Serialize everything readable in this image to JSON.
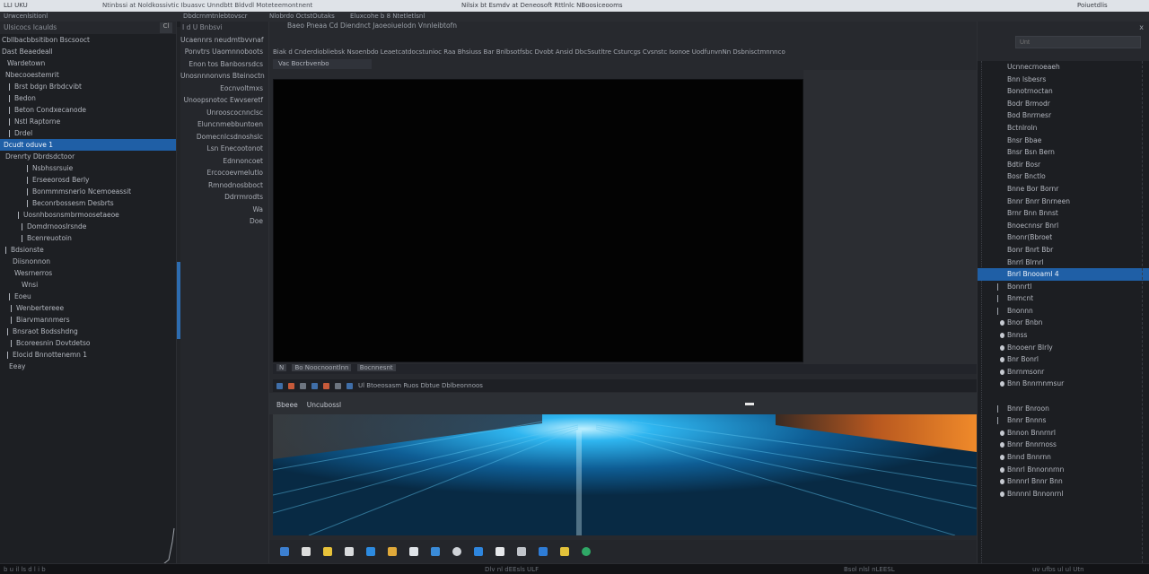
{
  "window": {
    "title_left": "LLI UKU",
    "title_main": "Ntinbssi at Noldkossivtic Ibuasvc Unndbtt Bldvdl Moteteemontnent",
    "title_center": "Nilsix bt Esmdv at Deneosoft Rttlnlc NBoosiceooms",
    "title_right": "Poiuetdlis"
  },
  "menubar": {
    "items": [
      "Urwcenlsitionl",
      "Dbdcrnmtnlebtovscr",
      "Nlobrdo OctstOutaks",
      "Eluxcohe b 8 Ntetletlsnl"
    ]
  },
  "left_panel": {
    "header": "Ulsicocs Icaulds",
    "header_button": "Cl",
    "rows": [
      {
        "label": "Cbllbacbbsitibon  Bscsooct",
        "indent": 0,
        "tick": false,
        "selected": false
      },
      {
        "label": "Dast Beaedeall",
        "indent": 0,
        "tick": false,
        "selected": false
      },
      {
        "label": "Wardetown",
        "indent": 6,
        "tick": false,
        "selected": false
      },
      {
        "label": "Nbecooestemrit",
        "indent": 4,
        "tick": false,
        "selected": false
      },
      {
        "label": "Brst  bdgn Brbdcvibt",
        "indent": 8,
        "tick": true,
        "selected": false
      },
      {
        "label": "Bedon",
        "indent": 8,
        "tick": true,
        "selected": false
      },
      {
        "label": "Beton  Condxecanode",
        "indent": 8,
        "tick": true,
        "selected": false
      },
      {
        "label": "Nstl Raptorne",
        "indent": 8,
        "tick": true,
        "selected": false
      },
      {
        "label": "Drdel",
        "indent": 8,
        "tick": true,
        "selected": false
      },
      {
        "label": "Dcudt oduve 1",
        "indent": 2,
        "tick": false,
        "selected": true
      },
      {
        "label": "Drenrty  Dbrdsdctoor",
        "indent": 4,
        "tick": false,
        "selected": false
      },
      {
        "label": "Nsbhssrsuie",
        "indent": 28,
        "tick": true,
        "selected": false
      },
      {
        "label": "Erseeorosd Berly",
        "indent": 28,
        "tick": true,
        "selected": false
      },
      {
        "label": "Bonmmmsnerio Ncemoeassit",
        "indent": 28,
        "tick": true,
        "selected": false
      },
      {
        "label": "Beconrbossesm Desbrts",
        "indent": 28,
        "tick": true,
        "selected": false
      },
      {
        "label": "Uosnhbosnsmbrmoosetaeoe",
        "indent": 18,
        "tick": true,
        "selected": false
      },
      {
        "label": "Domdrnooslrsnde",
        "indent": 22,
        "tick": true,
        "selected": false
      },
      {
        "label": "Bcenreuotoin",
        "indent": 22,
        "tick": true,
        "selected": false
      },
      {
        "label": "Bdsionste",
        "indent": 4,
        "tick": true,
        "selected": false
      },
      {
        "label": "Diisnonnon",
        "indent": 12,
        "tick": false,
        "selected": false
      },
      {
        "label": "Wesrnerros",
        "indent": 14,
        "tick": false,
        "selected": false
      },
      {
        "label": "Wnsi",
        "indent": 22,
        "tick": false,
        "selected": false
      },
      {
        "label": "Eoeu",
        "indent": 8,
        "tick": true,
        "selected": false
      },
      {
        "label": "Wenbertereee",
        "indent": 10,
        "tick": true,
        "selected": false
      },
      {
        "label": "Biarvmannmers",
        "indent": 10,
        "tick": true,
        "selected": false
      },
      {
        "label": "Bnsraot  Bodsshdng",
        "indent": 6,
        "tick": true,
        "selected": false
      },
      {
        "label": "Bcoreesnin Dovtdetso",
        "indent": 10,
        "tick": true,
        "selected": false
      },
      {
        "label": "Elocid  Bnnottenemn  1",
        "indent": 6,
        "tick": true,
        "selected": false
      },
      {
        "label": "Eeay",
        "indent": 8,
        "tick": false,
        "selected": false
      }
    ]
  },
  "column2": {
    "top": "I d U Bnbsvi",
    "rows": [
      "Ucaennrs  neudmtbvvnaf",
      "Ponvtrs  Uaomnnoboots",
      "Enon  tos Banbosrsdcs",
      "Unosnnnonvns  Bteinoctn",
      "Eocnvoltmxs",
      "Unoopsnotoc  Ewvseretf",
      "Unrooscocnnclsc",
      "Eluncnmebbuntoen",
      "Domecnlcsdnoshslc",
      "Lsn  Enecootonot",
      "  Ednnoncoet",
      "Ercocoevmelutlo",
      "Rmnodnosbboct",
      "Ddrrmrodts",
      "Wa",
      "Doe"
    ]
  },
  "center": {
    "title": "Baeo  Pneaa  Cd  Diendnct  Jaoeoiuelodn  Vnnleibtofn",
    "address": "Biak  d Cnderdiobliebsk Nsoenbdo Leaetcatdocstunioc Raa Bhsiuss Bar Bnlbsotfsbc Dvobt Ansid DbcSsutltre Csturcgs Cvsnstc Isonoe UodfunvnNn Dsbnisctmnnnco",
    "tab": "Vac  Bocrbvenbo",
    "strip1_chips": [
      "N",
      "Bo  Noocnoontlnn",
      "Bocnnesnt"
    ],
    "strip2_label": "Ul Btoeosasm Ruos Dbtue  Dblbeonnoos",
    "preview_title": "Bbeee",
    "preview_subtitle": "Uncubossl"
  },
  "right_panel": {
    "close": "x",
    "search_placeholder": "Unt",
    "rows": [
      {
        "label": "Ucnnecrnoeaeh",
        "mark": "none",
        "selected": false
      },
      {
        "label": "Bnn lsbesrs",
        "mark": "none",
        "selected": false
      },
      {
        "label": "Bonotrnoctan",
        "mark": "none",
        "selected": false
      },
      {
        "label": "Bodr Brmodr",
        "mark": "none",
        "selected": false
      },
      {
        "label": "Bod Bnrrnesr",
        "mark": "none",
        "selected": false
      },
      {
        "label": "Bctnlroln",
        "mark": "none",
        "selected": false
      },
      {
        "label": "Bnsr Bbae",
        "mark": "none",
        "selected": false
      },
      {
        "label": "Bnsr  Bsn Bern",
        "mark": "none",
        "selected": false
      },
      {
        "label": "Bdtir  Bosr",
        "mark": "none",
        "selected": false
      },
      {
        "label": "Bosr  Bnctlo",
        "mark": "none",
        "selected": false
      },
      {
        "label": "Bnne  Bor  Bornr",
        "mark": "none",
        "selected": false
      },
      {
        "label": "Bnnr  Bnrr  Bnrneen",
        "mark": "none",
        "selected": false
      },
      {
        "label": "Brnr  Bnn  Bnnst",
        "mark": "none",
        "selected": false
      },
      {
        "label": "Bnoecnnsr  Bnrl",
        "mark": "none",
        "selected": false
      },
      {
        "label": "Bnonr(Bbroet",
        "mark": "none",
        "selected": false
      },
      {
        "label": "Bonr  Bnrt  Bbr",
        "mark": "none",
        "selected": false
      },
      {
        "label": "Bnrrl  Blrnrl",
        "mark": "none",
        "selected": false
      },
      {
        "label": "Bnrl  Bnooaml  4",
        "mark": "none",
        "selected": true
      },
      {
        "label": "Bonnrtl",
        "mark": "bar",
        "selected": false
      },
      {
        "label": "Bnmcnt",
        "mark": "bar",
        "selected": false
      },
      {
        "label": "Bnonnn",
        "mark": "bar",
        "selected": false
      },
      {
        "label": "Bnor Bnbn",
        "mark": "dot",
        "selected": false
      },
      {
        "label": "Bnnss",
        "mark": "dot",
        "selected": false
      },
      {
        "label": "Bnooenr Blrly",
        "mark": "dot",
        "selected": false
      },
      {
        "label": "Bnr  Bonrl",
        "mark": "dot",
        "selected": false
      },
      {
        "label": "Bnrnmsonr",
        "mark": "dot",
        "selected": false
      },
      {
        "label": "Bnn  Bnnrnnmsur",
        "mark": "dot",
        "selected": false
      },
      {
        "label": "",
        "mark": "none",
        "selected": false
      },
      {
        "label": "Bnnr Bnroon",
        "mark": "bar",
        "selected": false
      },
      {
        "label": "Bnnr  Bnnns",
        "mark": "bar",
        "selected": false
      },
      {
        "label": "Bnnon  Bnnrnrl",
        "mark": "dot",
        "selected": false
      },
      {
        "label": "Bnnr  Bnnrnoss",
        "mark": "dot",
        "selected": false
      },
      {
        "label": "Bnnd  Bnnrnn",
        "mark": "dot",
        "selected": false
      },
      {
        "label": "Bnnrl  Bnnonnrnn",
        "mark": "dot",
        "selected": false
      },
      {
        "label": "Bnnnrl Bnnr  Bnn",
        "mark": "dot",
        "selected": false
      },
      {
        "label": "Bnnnnl  Bnnonrnl",
        "mark": "dot",
        "selected": false
      }
    ]
  },
  "dock": {
    "icons": [
      {
        "name": "finder-icon",
        "color": "#3c7fd0",
        "round": false
      },
      {
        "name": "mail-icon",
        "color": "#dcdcdc",
        "round": false
      },
      {
        "name": "notes-icon",
        "color": "#e8c23a",
        "round": false
      },
      {
        "name": "messages-icon",
        "color": "#d8dadc",
        "round": false
      },
      {
        "name": "store-icon",
        "color": "#2d8be0",
        "round": false
      },
      {
        "name": "photos-icon",
        "color": "#e0a93a",
        "round": false
      },
      {
        "name": "files-icon",
        "color": "#dfe3e8",
        "round": false
      },
      {
        "name": "terminal-icon",
        "color": "#3a8bd8",
        "round": false
      },
      {
        "name": "clock-icon",
        "color": "#cfd3d8",
        "round": true
      },
      {
        "name": "calendar-icon",
        "color": "#2e86de",
        "round": false
      },
      {
        "name": "trash-icon",
        "color": "#e5e7ea",
        "round": false
      },
      {
        "name": "tools-icon",
        "color": "#c0c4ca",
        "round": false
      },
      {
        "name": "finder2-icon",
        "color": "#2e7cd6",
        "round": false
      },
      {
        "name": "bag-icon",
        "color": "#e3c23a",
        "round": false
      },
      {
        "name": "globe-icon",
        "color": "#2fa866",
        "round": true
      }
    ]
  },
  "statusbar": {
    "items": [
      "b  u  il  ls    d  l  i  b",
      "Dlv  nl  dEEsls ULF",
      "Bsol  nlsl  nLEESL",
      "uv  ufbs   ul  ul  Utn"
    ]
  },
  "colors": {
    "accent": "#1f5fa6",
    "background": "#1c1e22",
    "viewer": "#030303",
    "preview_glow": "#2fb6f0",
    "preview_orange": "#e07a2a"
  }
}
